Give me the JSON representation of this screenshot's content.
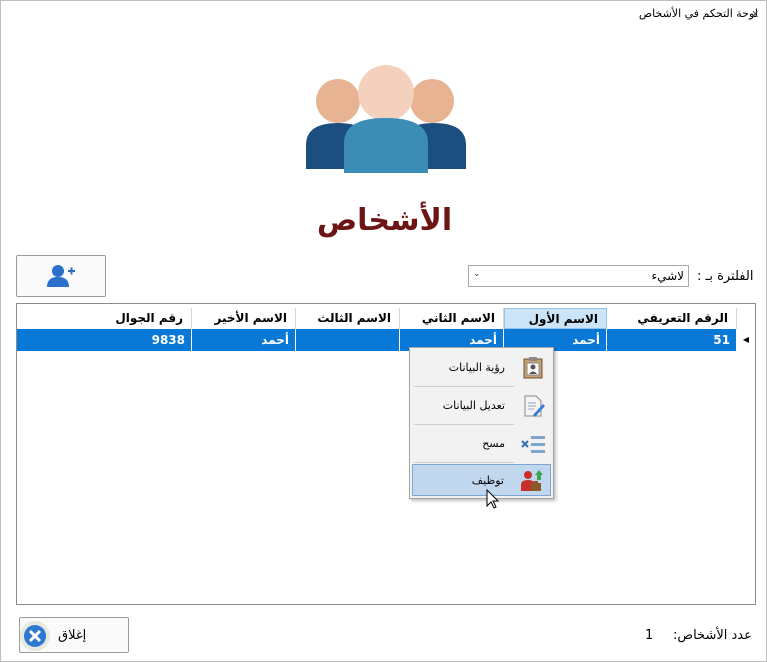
{
  "window": {
    "title": "لوحة التحكم في الأشخاص",
    "close_glyph": "x"
  },
  "page": {
    "title": "الأشخاص"
  },
  "filter": {
    "label": "الفلترة بـ :",
    "selected": "لاشيء"
  },
  "table": {
    "columns": [
      "الرقم التعريفي",
      "الاسم الأول",
      "الاسم الثاني",
      "الاسم الثالث",
      "الاسم الأخير",
      "رقم الجوال"
    ],
    "rows": [
      {
        "id": "51",
        "first": "أحمد",
        "second": "أحمد",
        "third": "",
        "last": "أحمد",
        "phone": "9838"
      }
    ]
  },
  "context_menu": {
    "items": [
      {
        "label": "رؤية البيانات",
        "icon": "id-card-icon"
      },
      {
        "label": "تعديل البيانات",
        "icon": "edit-document-icon"
      },
      {
        "label": "مسح",
        "icon": "delete-icon"
      },
      {
        "label": "توظيف",
        "icon": "hire-person-icon"
      }
    ],
    "highlighted_index": 3
  },
  "footer": {
    "count_label": "عدد الأشخاص:",
    "count_value": "1",
    "close_label": "إغلاق"
  },
  "colors": {
    "accent": "#0a78d7",
    "title": "#6d1515",
    "menu_highlight": "#c1d7ee"
  }
}
